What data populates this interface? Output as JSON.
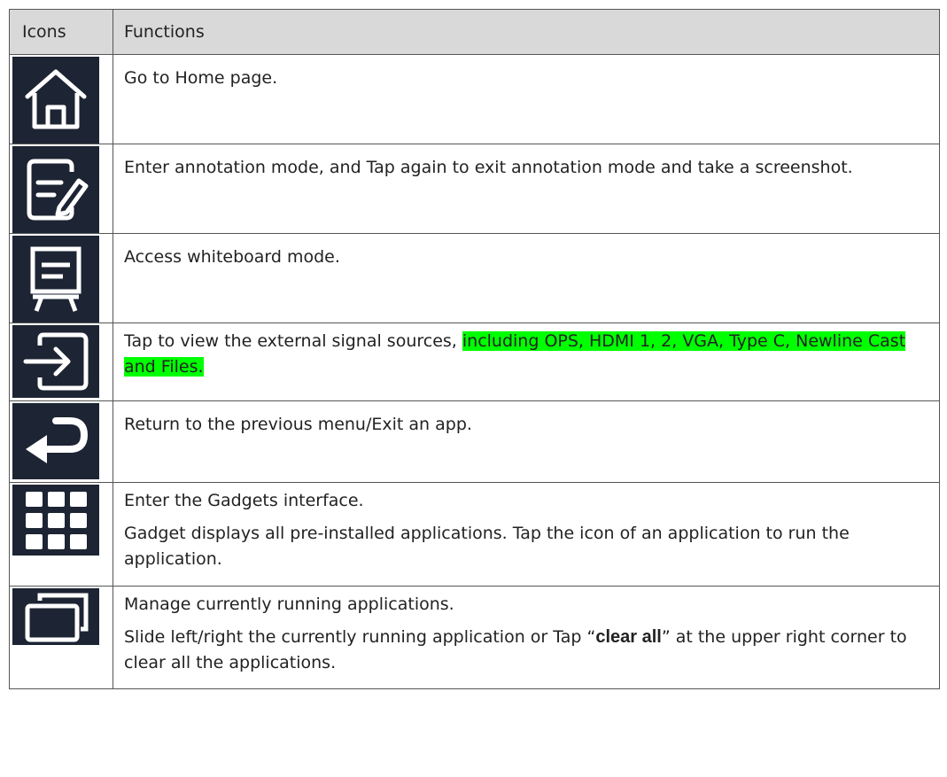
{
  "header": {
    "icons": "Icons",
    "functions": "Functions"
  },
  "rows": [
    {
      "icon": "home-icon",
      "lines": [
        "Go to Home page."
      ]
    },
    {
      "icon": "annotation-icon",
      "lines": [
        "Enter annotation mode, and Tap again to exit annotation mode and take a screenshot."
      ]
    },
    {
      "icon": "whiteboard-icon",
      "lines": [
        "Access whiteboard mode."
      ]
    },
    {
      "icon": "input-source-icon",
      "text_plain": "Tap to view the external signal sources, ",
      "text_highlight": "including OPS, HDMI 1, 2, VGA, Type C, Newline Cast and Files.",
      "highlight_color": "#00ff00"
    },
    {
      "icon": "back-icon",
      "lines": [
        "Return to the previous menu/Exit an app."
      ]
    },
    {
      "icon": "apps-grid-icon",
      "lines": [
        "Enter the Gadgets interface.",
        "Gadget displays all pre-installed applications. Tap the icon of an application to run the application."
      ]
    },
    {
      "icon": "multitask-icon",
      "line1": "Manage currently running applications.",
      "line2_a": "Slide left/right the currently running application or Tap “",
      "line2_bold": "clear all",
      "line2_b": "” at the upper right corner to clear all the applications."
    }
  ],
  "colors": {
    "icon_bg": "#1d2433",
    "header_bg": "#d9d9d9",
    "border": "#555555"
  }
}
